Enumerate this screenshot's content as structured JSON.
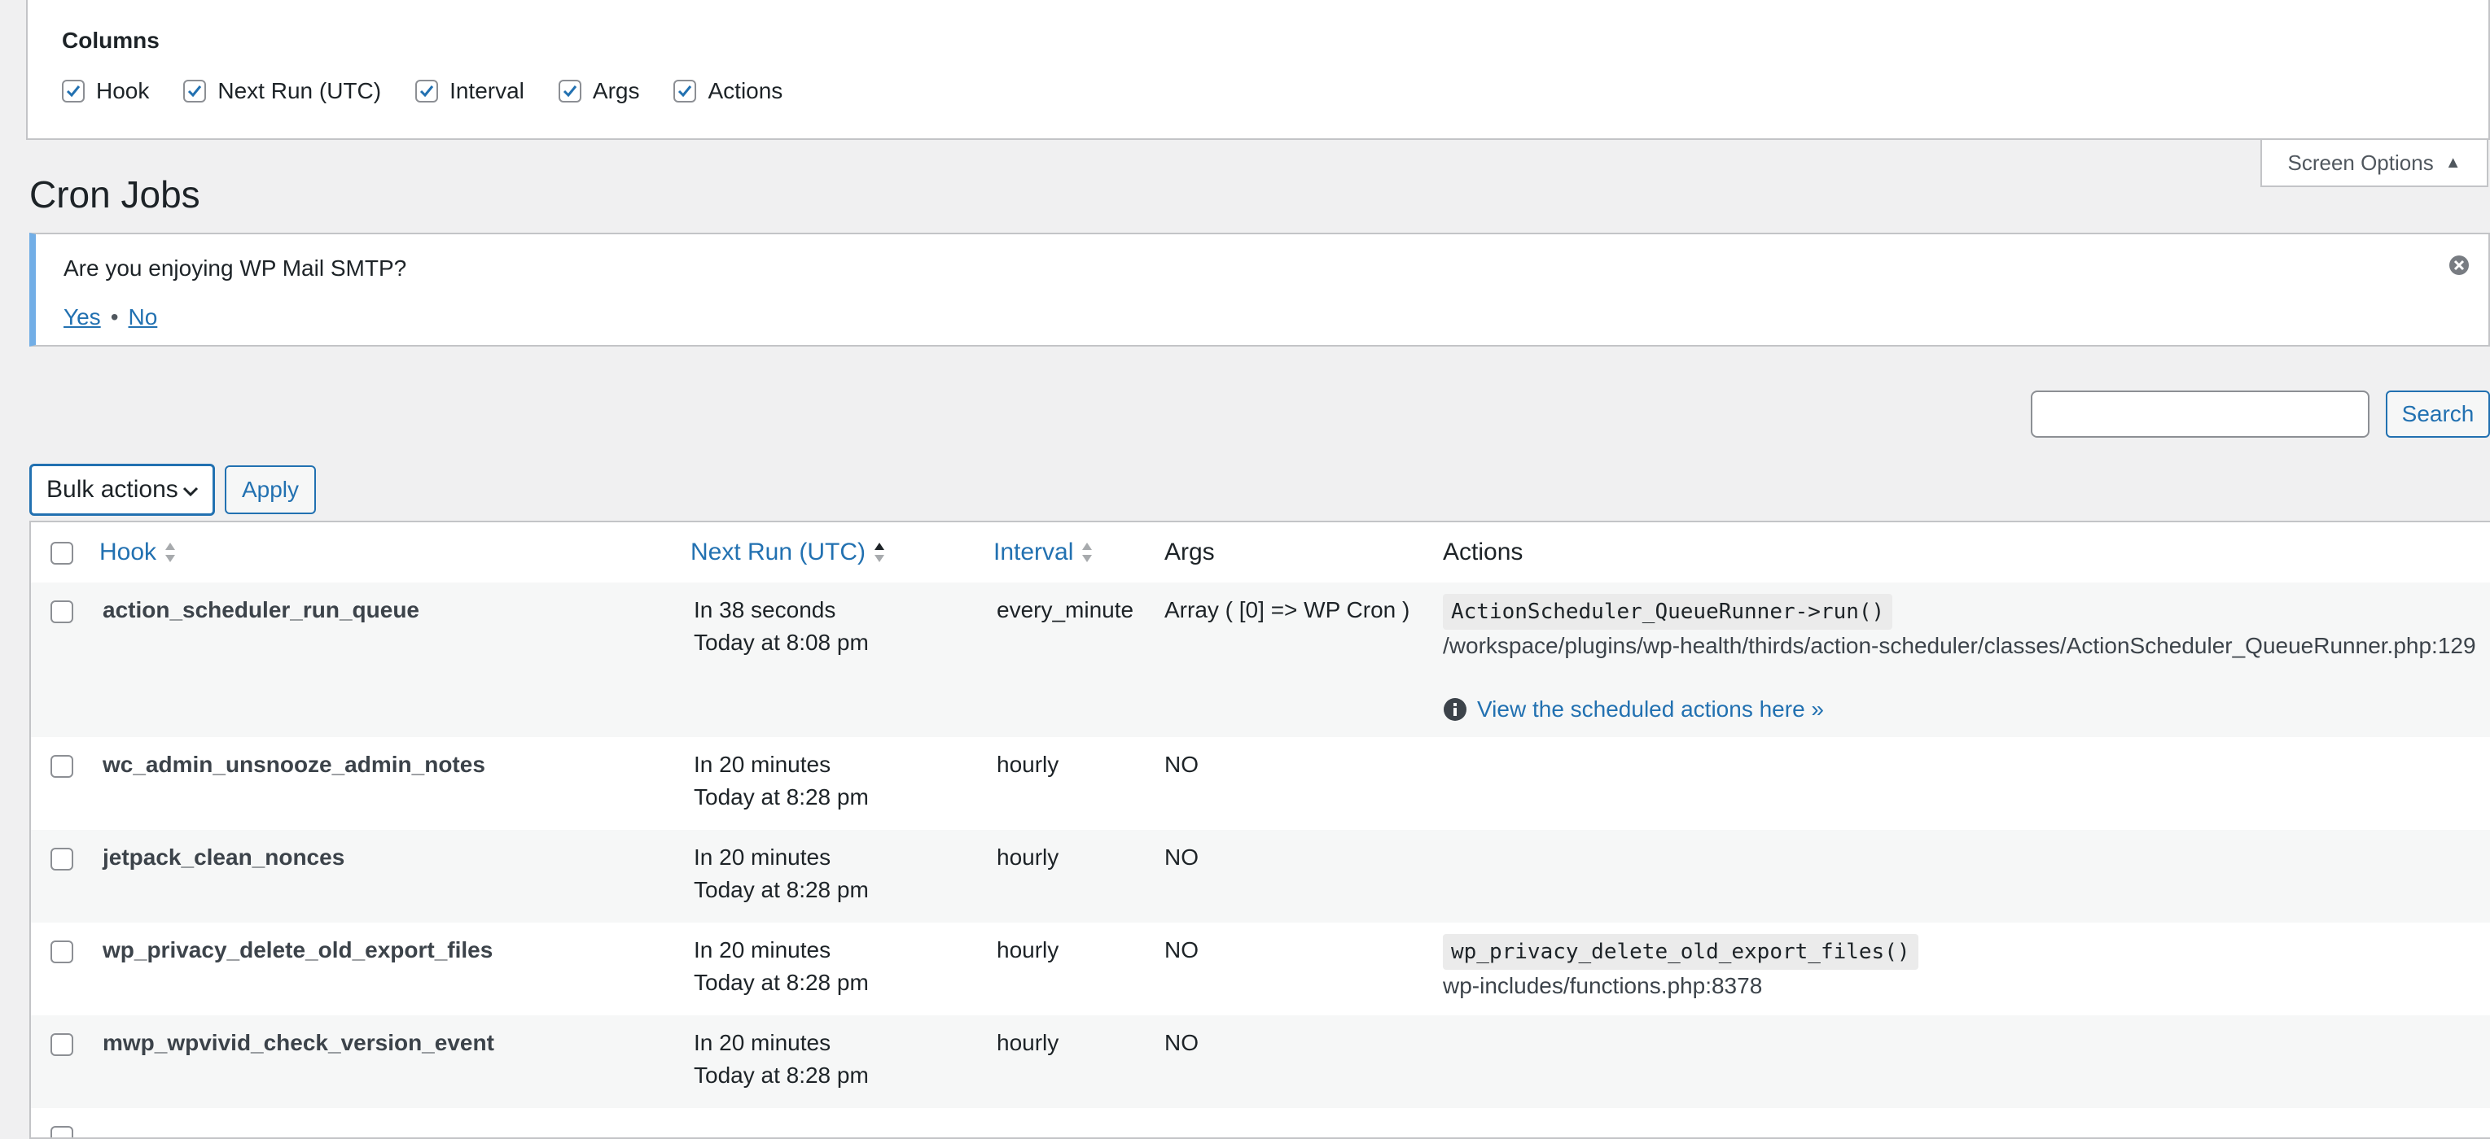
{
  "screen_options": {
    "columns_heading": "Columns",
    "columns": [
      {
        "label": "Hook",
        "checked": true
      },
      {
        "label": "Next Run (UTC)",
        "checked": true
      },
      {
        "label": "Interval",
        "checked": true
      },
      {
        "label": "Args",
        "checked": true
      },
      {
        "label": "Actions",
        "checked": true
      }
    ],
    "toggle_label": "Screen Options"
  },
  "page": {
    "title": "Cron Jobs"
  },
  "notice": {
    "text": "Are you enjoying WP Mail SMTP?",
    "yes_label": "Yes",
    "separator": "•",
    "no_label": "No"
  },
  "search": {
    "value": "",
    "button_label": "Search"
  },
  "bulk": {
    "selected": "Bulk actions",
    "apply_label": "Apply"
  },
  "table": {
    "headers": {
      "hook": "Hook",
      "next_run": "Next Run (UTC)",
      "interval": "Interval",
      "args": "Args",
      "actions": "Actions"
    },
    "rows": [
      {
        "hook": "action_scheduler_run_queue",
        "next_run_relative": "In 38 seconds",
        "next_run_absolute": "Today at 8:08 pm",
        "interval": "every_minute",
        "args": "Array ( [0] => WP Cron )",
        "action_code": "ActionScheduler_QueueRunner->run()",
        "action_path": "/workspace/plugins/wp-health/thirds/action-scheduler/classes/ActionScheduler_QueueRunner.php:129",
        "action_link": "View the scheduled actions here »"
      },
      {
        "hook": "wc_admin_unsnooze_admin_notes",
        "next_run_relative": "In 20 minutes",
        "next_run_absolute": "Today at 8:28 pm",
        "interval": "hourly",
        "args": "NO"
      },
      {
        "hook": "jetpack_clean_nonces",
        "next_run_relative": "In 20 minutes",
        "next_run_absolute": "Today at 8:28 pm",
        "interval": "hourly",
        "args": "NO"
      },
      {
        "hook": "wp_privacy_delete_old_export_files",
        "next_run_relative": "In 20 minutes",
        "next_run_absolute": "Today at 8:28 pm",
        "interval": "hourly",
        "args": "NO",
        "action_code": "wp_privacy_delete_old_export_files()",
        "action_path": "wp-includes/functions.php:8378"
      },
      {
        "hook": "mwp_wpvivid_check_version_event",
        "next_run_relative": "In 20 minutes",
        "next_run_absolute": "Today at 8:28 pm",
        "interval": "hourly",
        "args": "NO"
      }
    ]
  },
  "colors": {
    "link": "#2271b1",
    "notice_border": "#72aee6",
    "row_alt": "#f6f7f7"
  }
}
